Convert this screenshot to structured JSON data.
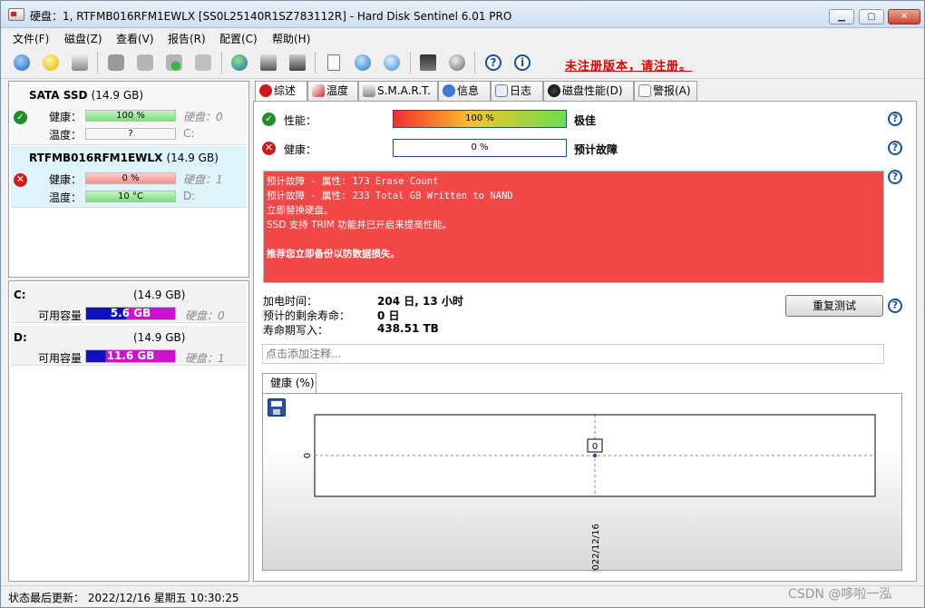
{
  "title": "硬盘：1, RTFMB016RFM1EWLX [SS0L25140R1SZ783112R]  -  Hard Disk Sentinel 6.01 PRO",
  "window_buttons": {
    "minimize": "▁",
    "maximize": "▢",
    "close": "✕"
  },
  "menu": [
    "文件(F)",
    "磁盘(Z)",
    "查看(V)",
    "报告(R)",
    "配置(C)",
    "帮助(H)"
  ],
  "toolbar": {
    "register_text": "未注册版本，请注册。"
  },
  "disks": [
    {
      "name": "SATA SSD",
      "size": "(14.9 GB)",
      "health_label": "健康：",
      "health_value": "100 %",
      "health_fraction": 1.0,
      "temp_label": "温度：",
      "temp_value": "?",
      "disk_label": "硬盘：0",
      "drive": "C:"
    },
    {
      "name": "RTFMB016RFM1EWLX",
      "size": "(14.9 GB)",
      "health_label": "健康：",
      "health_value": "0 %",
      "health_fraction": 0.0,
      "temp_label": "温度：",
      "temp_value": "10 °C",
      "disk_label": "硬盘：1",
      "drive": "D:"
    }
  ],
  "volumes": [
    {
      "letter": "C:",
      "size": "(14.9 GB)",
      "free_label": "可用容量",
      "free_value": "5.6 GB",
      "disk_label": "硬盘：0"
    },
    {
      "letter": "D:",
      "size": "(14.9 GB)",
      "free_label": "可用容量",
      "free_value": "11.6 GB",
      "disk_label": "硬盘：1"
    }
  ],
  "tabs": [
    "综述",
    "温度",
    "S.M.A.R.T.",
    "信息",
    "日志",
    "磁盘性能(D)",
    "警报(A)"
  ],
  "overview": {
    "performance_label": "性能：",
    "performance_value": "100 %",
    "performance_fraction": 1.0,
    "performance_rating": "极佳",
    "health_label": "健康：",
    "health_value": "0 %",
    "health_fraction": 0.0,
    "health_rating": "预计故障",
    "alert_lines": [
      "预计故障 - 属性: 173 Erase Count",
      "预计故障 - 属性: 233 Total GB Written to NAND",
      "立即替换硬盘。",
      "SSD 支持 TRIM 功能并已开启来提高性能。",
      "",
      "推荐您立即备份以防数据损失。"
    ],
    "power_on_label": "加电时间：",
    "power_on_value": "204 日, 13 小时",
    "remaining_label": "预计的剩余寿命：",
    "remaining_value": "0 日",
    "written_label": "寿命期写入：",
    "written_value": "438.51 TB",
    "retest_button": "重复测试",
    "comment_placeholder": "点击添加注释...",
    "chart_tab": "健康 (%)"
  },
  "chart_data": {
    "type": "line",
    "x": [
      "2022/12/16"
    ],
    "series": [
      {
        "values": [
          0
        ]
      }
    ],
    "y_ticks": [
      "0"
    ],
    "data_labels": [
      "0"
    ]
  },
  "status": {
    "text": "状态最后更新： 2022/12/16 星期五 10:30:25"
  },
  "watermark": "CSDN @哆啦一泓"
}
